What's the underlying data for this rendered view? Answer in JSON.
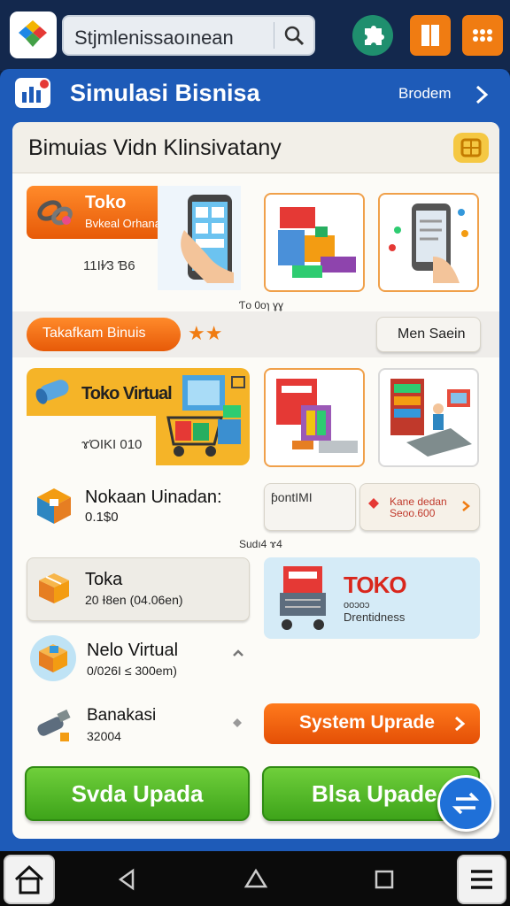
{
  "top_bar": {
    "search_text": "Stjmlenissaoınean"
  },
  "header": {
    "title": "Simulasi Bisnisa",
    "right_label": "Brodem"
  },
  "panel": {
    "title": "Bimuias Vidn Klinsivatany"
  },
  "toko_banner": {
    "title": "Toko",
    "subtitle": "Bvkeal Orhana",
    "code": "11IƗ⁄3 Ɓ6"
  },
  "caption_1": "Ƭo 0oɿ ɣɣ",
  "strip": {
    "pill_label": "Takafkam Binuis",
    "stars": "★★",
    "button_label": "Men Saein"
  },
  "virtual_banner": {
    "title": "Toko Virtual",
    "code": "ɤΌIKI 010"
  },
  "nokaan": {
    "title": "Nokaan Uinadan:",
    "value": "0.1$0"
  },
  "pontim": {
    "label": "ƥontIMI"
  },
  "kane_card": {
    "line1": "Kane dedan",
    "line2": "Seoo.600"
  },
  "caption_2": "Sudı4 ɤ4",
  "toka_card": {
    "title": "Toka",
    "subtitle": "20 Ɨ8en (04.06en)"
  },
  "toko_ad": {
    "title": "TOKO",
    "line1": "ooɔoɔ",
    "line2": "Drentidness"
  },
  "nelo": {
    "title": "Nelo Virtual",
    "subtitle": "0/026I ≤ 300em)"
  },
  "banakasi": {
    "title": "Banakasi",
    "subtitle": "32004"
  },
  "system_upgrade": {
    "label": "System Uprade"
  },
  "buttons": {
    "left": "Svda Upada",
    "right": "Blsa Upade"
  },
  "colors": {
    "frame_blue": "#1e5bb8",
    "accent_orange": "#f07c12",
    "green": "#4bb522",
    "nav_dark": "#0b0b0b"
  }
}
